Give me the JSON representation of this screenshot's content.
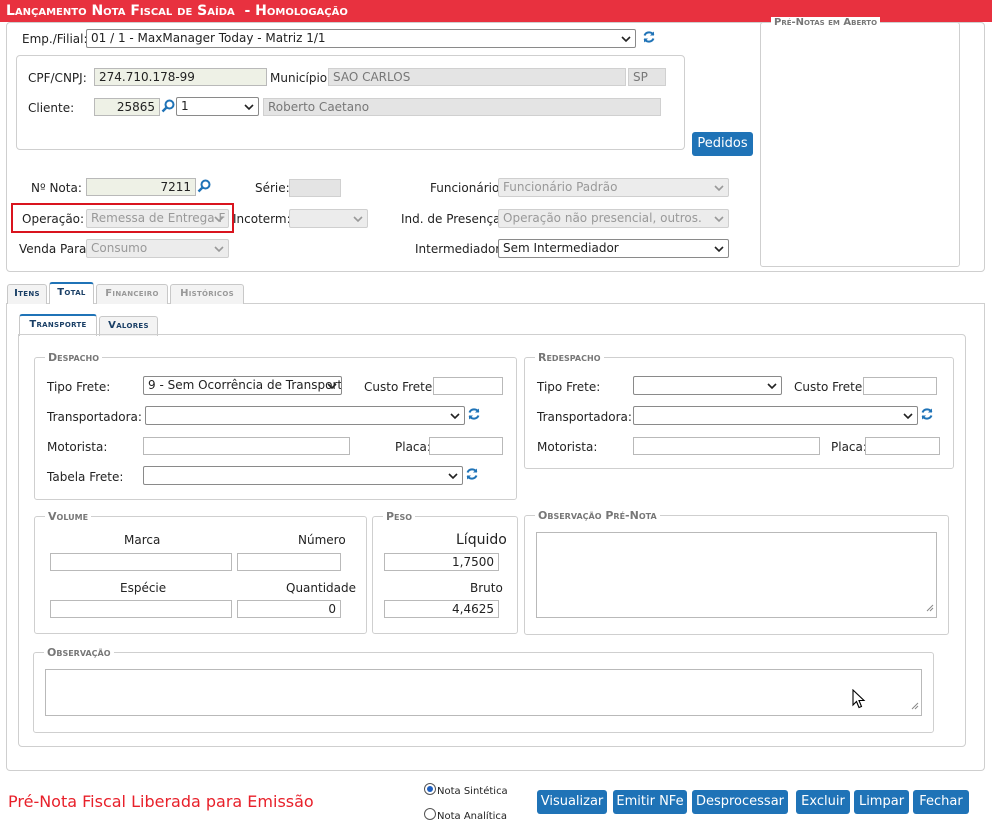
{
  "title": "Lançamento Nota Fiscal de Saída  - Homologação",
  "empfilial": {
    "label": "Emp./Filial:",
    "value": "01 / 1 - MaxManager Today - Matriz 1/1"
  },
  "pre_notas": {
    "legend": "Pré-Notas em Aberto"
  },
  "cpf": {
    "label": "CPF/CNPJ:",
    "value": "274.710.178-99"
  },
  "municipio": {
    "label": "Município:",
    "value": "SAO CARLOS",
    "uf": "SP"
  },
  "cliente": {
    "label": "Cliente:",
    "code": "25865",
    "seq": "1",
    "name": "Roberto Caetano"
  },
  "pedidos_button": "Pedidos",
  "nota": {
    "label": "Nº Nota:",
    "value": "7211"
  },
  "serie": {
    "label": "Série:",
    "value": ""
  },
  "funcionario": {
    "label": "Funcionário:",
    "value": "Funcionário Padrão"
  },
  "operacao": {
    "label": "Operação:",
    "value": "Remessa de Entrega F"
  },
  "incoterm": {
    "label": "Incoterm:",
    "value": ""
  },
  "presenca": {
    "label": "Ind. de Presença:",
    "value": "Operação não presencial, outros."
  },
  "venda": {
    "label": "Venda Para:",
    "value": "Consumo"
  },
  "intermediador": {
    "label": "Intermediador:",
    "value": "Sem Intermediador"
  },
  "tabs": [
    "Itens",
    "Total",
    "Financeiro",
    "Históricos"
  ],
  "subtabs": [
    "Transporte",
    "Valores"
  ],
  "despacho": {
    "legend": "Despacho",
    "tipo_frete_label": "Tipo Frete:",
    "tipo_frete_value": "9 - Sem Ocorrência de Transport",
    "custo_frete_label": "Custo Frete:",
    "custo_frete_value": "",
    "transportadora_label": "Transportadora:",
    "transportadora_value": "",
    "motorista_label": "Motorista:",
    "motorista_value": "",
    "placa_label": "Placa:",
    "placa_value": "",
    "tabela_frete_label": "Tabela Frete:",
    "tabela_frete_value": ""
  },
  "redespacho": {
    "legend": "Redespacho",
    "tipo_frete_label": "Tipo Frete:",
    "tipo_frete_value": "",
    "custo_frete_label": "Custo Frete:",
    "custo_frete_value": "",
    "transportadora_label": "Transportadora:",
    "transportadora_value": "",
    "motorista_label": "Motorista:",
    "motorista_value": "",
    "placa_label": "Placa:",
    "placa_value": ""
  },
  "volume": {
    "legend": "Volume",
    "marca_label": "Marca",
    "marca_value": "",
    "numero_label": "Número",
    "numero_value": "",
    "especie_label": "Espécie",
    "especie_value": "",
    "quantidade_label": "Quantidade",
    "quantidade_value": "0"
  },
  "peso": {
    "legend": "Peso",
    "liquido_label": "Líquido",
    "liquido_value": "1,7500",
    "bruto_label": "Bruto",
    "bruto_value": "4,4625"
  },
  "obs_pre_nota": {
    "legend": "Observação Pré-Nota",
    "value": ""
  },
  "observacao": {
    "legend": "Observação",
    "value": ""
  },
  "status": "Pré-Nota Fiscal Liberada para Emissão",
  "radios": {
    "sintetica": "Nota Sintética",
    "analitica": "Nota Analítica"
  },
  "buttons": {
    "visualizar": "Visualizar",
    "emitir": "Emitir NFe",
    "desprocessar": "Desprocessar",
    "excluir": "Excluir",
    "limpar": "Limpar",
    "fechar": "Fechar"
  },
  "colors": {
    "title_bar": "#e8313f",
    "button": "#1f73b7",
    "status_text": "#e8202a",
    "highlight": "#d9141e"
  }
}
